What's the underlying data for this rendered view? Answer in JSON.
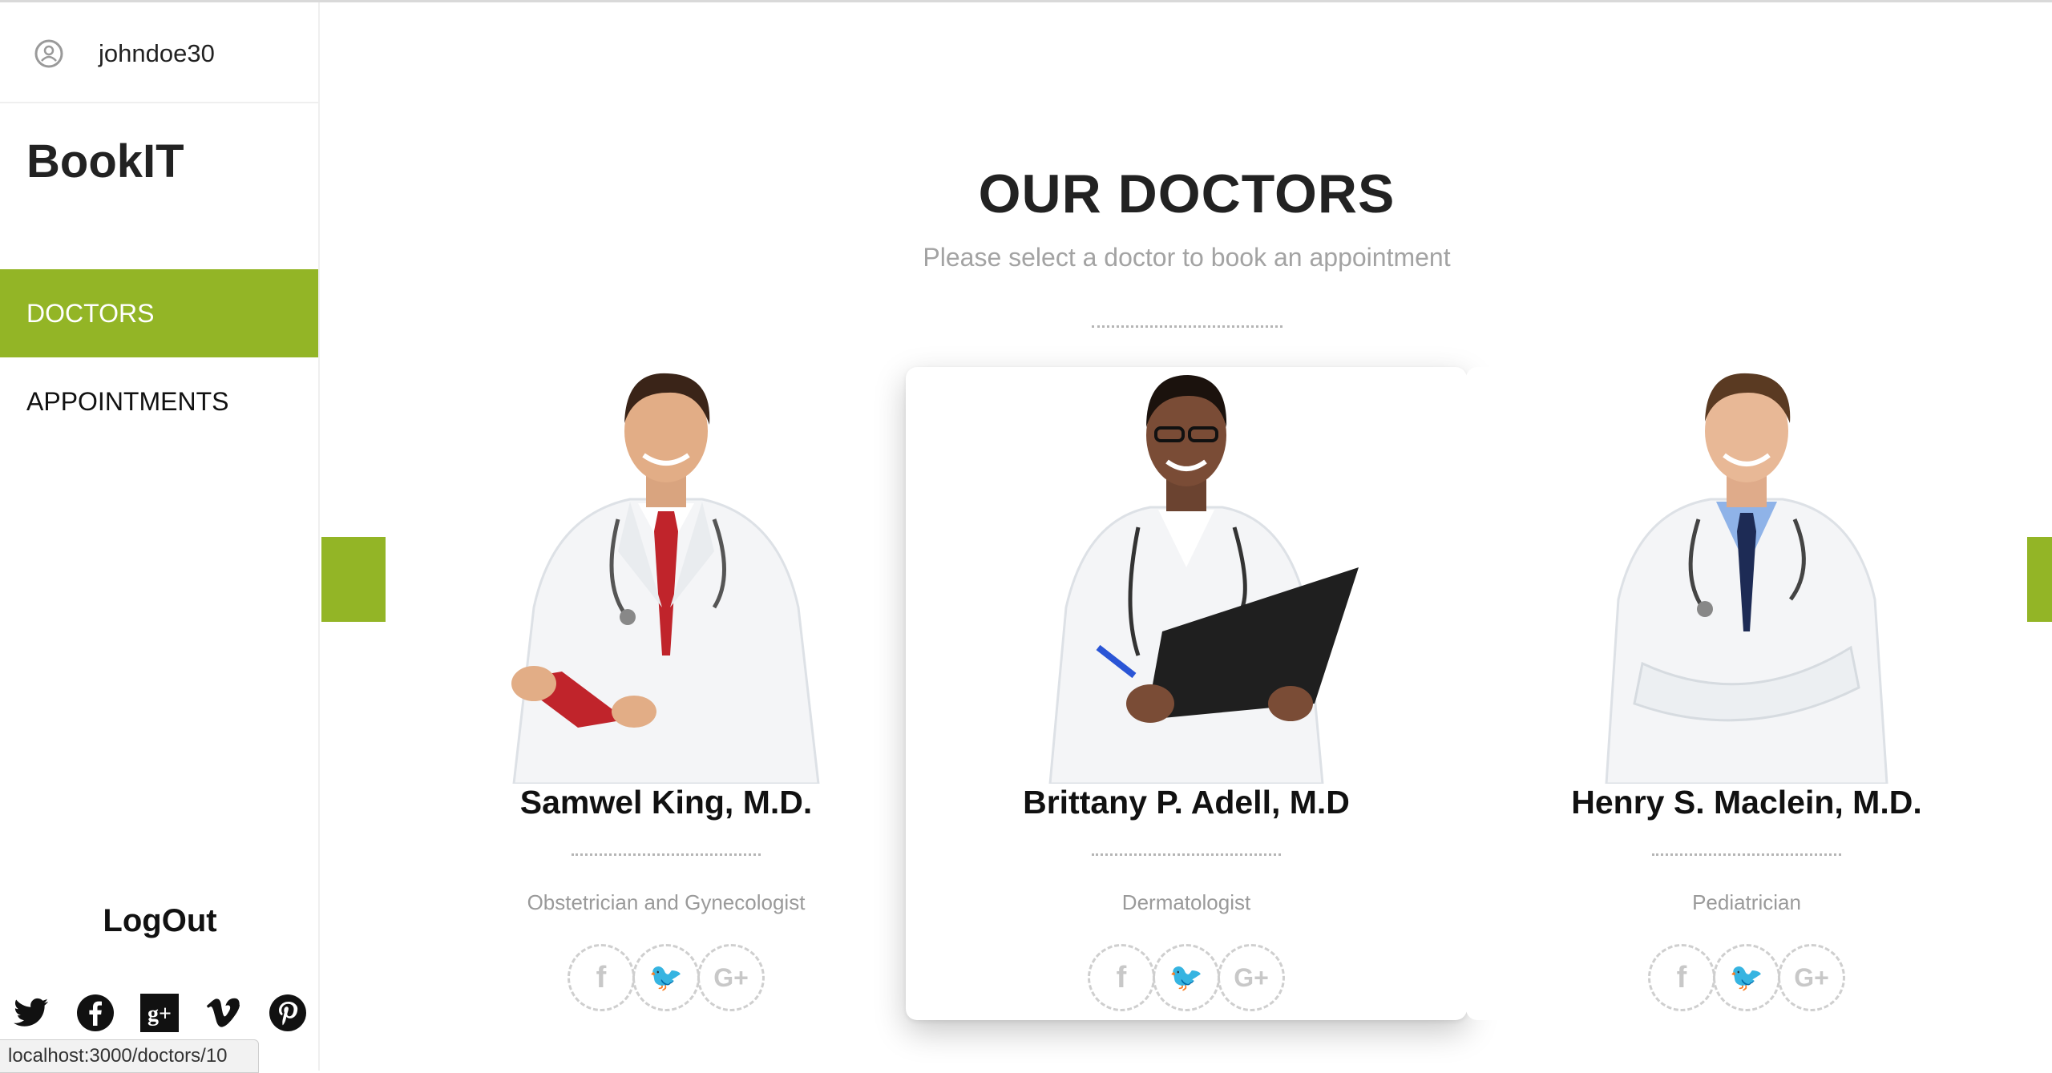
{
  "user": {
    "username": "johndoe30",
    "icon": "user-avatar-icon"
  },
  "brand": "BookIT",
  "nav": {
    "doctors": "DOCTORS",
    "appointments": "APPOINTMENTS",
    "active": "DOCTORS"
  },
  "logout": "LogOut",
  "sidebar_social": [
    "twitter-icon",
    "facebook-icon",
    "google-plus-icon",
    "vimeo-icon",
    "pinterest-icon"
  ],
  "status_url": "localhost:3000/doctors/10",
  "page": {
    "title": "OUR DOCTORS",
    "subtitle": "Please select a doctor to book an appointment"
  },
  "carousel": {
    "prev_label": "<",
    "next_label": ">"
  },
  "doctors": [
    {
      "name": "Samwel King, M.D.",
      "specialty": "Obstetrician and Gynecologist",
      "featured": false
    },
    {
      "name": "Brittany P. Adell, M.D",
      "specialty": "Dermatologist",
      "featured": true
    },
    {
      "name": "Henry S. Maclein, M.D.",
      "specialty": "Pediatrician",
      "featured": false
    }
  ],
  "social_glyphs": {
    "facebook": "f",
    "twitter": "🐦",
    "google_plus": "G+"
  },
  "colors": {
    "accent": "#93b526",
    "muted_text": "#a3a3a3",
    "dots": "#b5b5b5"
  }
}
